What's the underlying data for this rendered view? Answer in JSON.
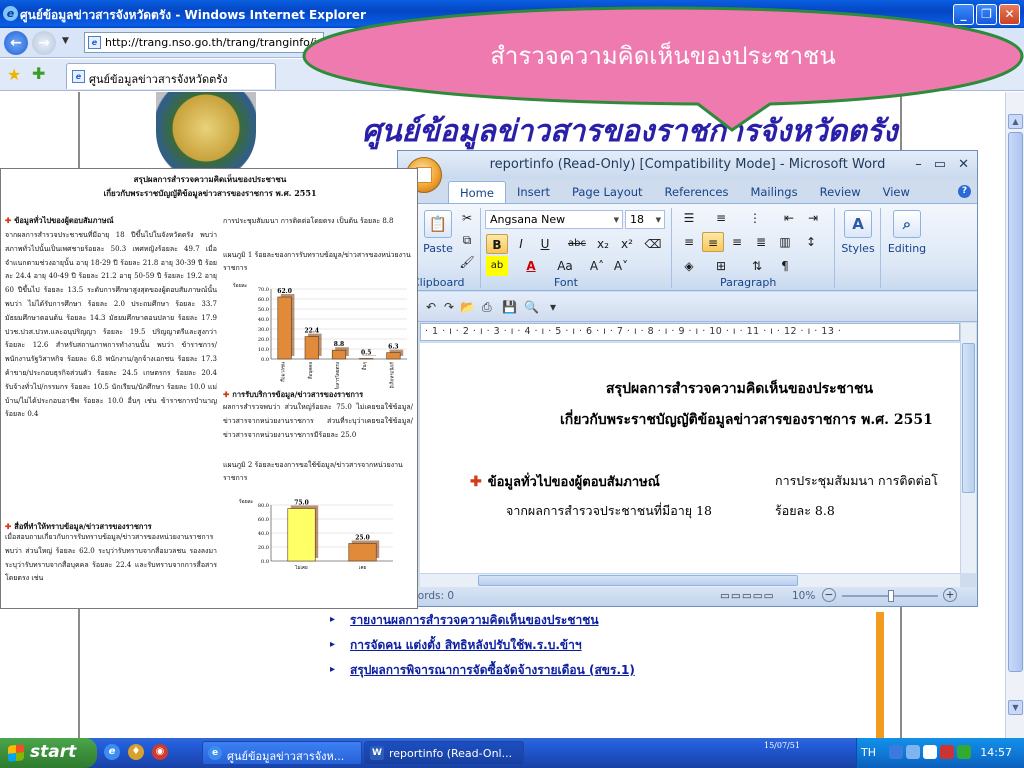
{
  "ie": {
    "title": "ศูนย์ข้อมูลข่าวสารจังหวัดตรัง - Windows Internet Explorer",
    "address": "http://trang.nso.go.th/trang/tranginfo/ind",
    "tab_label": "ศูนย์ข้อมูลข่าวสารจังหวัดตรัง",
    "icons": [
      "ie-icon",
      "back-icon",
      "forward-icon",
      "favorites-star-icon",
      "add-favorite-icon",
      "page-icon"
    ]
  },
  "site": {
    "heading": "ศูนย์ข้อมูลข่าวสารของราชการจังหวัดตรัง",
    "links": [
      "รายงานผลการสำรวจความคิดเห็นของประชาชน",
      "การจัดคน แต่งตั้ง สิทธิหลังปรับใช้พ.ร.บ.ข้าฯ",
      "สรุปผลการพิจารณาการจัดซื้อจัดจ้างรายเดือน (สขร.1)"
    ]
  },
  "callout": {
    "text": "สำรวจความคิดเห็นของประชาชน",
    "fill": "#ef7ab0",
    "stroke": "#2e8b3a"
  },
  "word": {
    "title": "reportinfo (Read-Only) [Compatibility Mode] - Microsoft Word",
    "tabs": [
      "Home",
      "Insert",
      "Page Layout",
      "References",
      "Mailings",
      "Review",
      "View"
    ],
    "active_tab": "Home",
    "font_name": "Angsana New",
    "font_size": "18",
    "groups": {
      "clipboard": "Clipboard",
      "font": "Font",
      "paragraph": "Paragraph",
      "styles": "Styles",
      "editing": "Editing",
      "paste": "Paste"
    },
    "ruler": "· 1 · ı · 2 · ı · 3 · ı · 4 · ı · 5 · ı · 6 · ı · 7 · ı · 8 · ı · 9 · ı · 10 · ı · 11 · ı · 12 · ı · 13 ·",
    "doc": {
      "title1": "สรุปผลการสำรวจความคิดเห็นของประชาชน",
      "title2": "เกี่ยวกับพระราชบัญญัติข้อมูลข่าวสารของราชการ พ.ศ. 2551",
      "heading1": "ข้อมูลทั่วไปของผู้ตอบสัมภาษณ์",
      "right1": "การประชุมสัมมนา การติดต่อโ",
      "para1": "จากผลการสำรวจประชาชนที่มีอายุ  18",
      "right2": "ร้อยละ  8.8"
    },
    "status_words": "Words: 0",
    "status_views": "▭▭▭▭▭",
    "zoom": "10%"
  },
  "report": {
    "title1": "สรุปผลการสำรวจความคิดเห็นของประชาชน",
    "title2": "เกี่ยวกับพระราชบัญญัติข้อมูลข่าวสารของราชการ พ.ศ. 2551",
    "h1": "ข้อมูลทั่วไปของผู้ตอบสัมภาษณ์",
    "left1": "จากผลการสำรวจประชาชนที่มีอายุ 18 ปีขึ้นไปในจังหวัดตรัง พบว่า สภาพทั่วไปนั้นเป็นเพศชายร้อยละ 50.3 เพศหญิงร้อยละ 49.7 เมื่อจำแนกตามช่วงอายุนั้น อายุ 18-29 ปี ร้อยละ 21.8 อายุ 30-39 ปี ร้อยละ 24.4 อายุ 40-49 ปี ร้อยละ 21.2 อายุ 50-59 ปี ร้อยละ 19.2 อายุ 60 ปีขึ้นไป ร้อยละ 13.5 ระดับการศึกษาสูงสุดของผู้ตอบสัมภาษณ์นั้น พบว่า ไม่ได้รับการศึกษา ร้อยละ 2.0 ประถมศึกษา ร้อยละ 33.7 มัธยมศึกษาตอนต้น ร้อยละ 14.3 มัธยมศึกษาตอนปลาย ร้อยละ 17.9 ปวช.ปวส.ปวท.และอนุปริญญา ร้อยละ 19.5 ปริญญาตรีและสูงกว่า ร้อยละ 12.6 สำหรับสถานภาพการทำงานนั้น พบว่า ข้าราชการ/พนักงานรัฐวิสาหกิจ ร้อยละ 6.8 พนักงาน/ลูกจ้างเอกชน ร้อยละ 17.3 ค้าขาย/ประกอบธุรกิจส่วนตัว ร้อยละ 24.5 เกษตรกร ร้อยละ 20.4 รับจ้างทั่วไป/กรรมกร ร้อยละ 10.5 นักเรียน/นักศึกษา ร้อยละ 10.0 แม่บ้าน/ไม่ได้ประกอบอาชีพ ร้อยละ 10.0 อื่นๆ เช่น ข้าราชการบำนาญ ร้อยละ 0.4",
    "h2": "สื่อที่ทำให้ทราบข้อมูล/ข่าวสารของราชการ",
    "left2": "เมื่อสอบถามเกี่ยวกับการรับทราบข้อมูล/ข่าวสารของหน่วยงานราชการ พบว่า ส่วนใหญ่ ร้อยละ 62.0 ระบุว่ารับทราบจากสื่อมวลชน รองลงมา ระบุว่ารับทราบจากสื่อบุคคล ร้อยละ 22.4 และรับทราบจากการสื่อสารโดยตรง เช่น",
    "right1": "การประชุมสัมมนา การติดต่อโดยตรง เป็นต้น ร้อยละ 8.8",
    "cap1": "แผนภูมิ 1  ร้อยละของการรับทราบข้อมูล/ข่าวสารของหน่วยงานราชการ",
    "h3": "การรับบริการข้อมูล/ข่าวสารของราชการ",
    "right2": "ผลการสำรวจพบว่า ส่วนใหญ่ร้อยละ 75.0 ไม่เคยขอใช้ข้อมูล/ข่าวสารจากหน่วยงานราชการ ส่วนที่ระบุว่าเคยขอใช้ข้อมูล/ข่าวสารจากหน่วยงานราชการมีร้อยละ 25.0",
    "cap2": "แผนภูมิ 2  ร้อยละของการขอใช้ข้อมูล/ข่าวสารจากหน่วยงานราชการ"
  },
  "chart_data": [
    {
      "type": "bar",
      "ylabel": "ร้อยละ",
      "ylim": [
        0,
        70
      ],
      "yticks": [
        "0.0",
        "10.0",
        "20.0",
        "30.0",
        "40.0",
        "50.0",
        "60.0",
        "70.0"
      ],
      "categories": [
        "สื่อมวลชน",
        "สื่อบุคคล",
        "สื่อสารโดยตรง",
        "อื่นๆ",
        "อิเล็กทรอนิกส์"
      ],
      "values": [
        62.0,
        22.4,
        8.8,
        0.5,
        6.3
      ],
      "labels": [
        "62.0",
        "22.4",
        "8.8",
        "0.5",
        "6.3"
      ],
      "bar_color": "#e08a3a"
    },
    {
      "type": "bar",
      "ylabel": "ร้อยละ",
      "ylim": [
        0,
        80
      ],
      "yticks": [
        "0.0",
        "20.0",
        "40.0",
        "60.0",
        "80.0"
      ],
      "categories": [
        "ไม่เคย",
        "เคย"
      ],
      "values": [
        75.0,
        25.0
      ],
      "labels": [
        "75.0",
        "25.0"
      ],
      "bar_colors": [
        "#ffff66",
        "#e08a3a"
      ]
    }
  ],
  "taskbar": {
    "start": "start",
    "tasks": [
      "ศูนย์ข้อมูลข่าวสารจังห...",
      "reportinfo (Read-Onl..."
    ],
    "lang": "TH",
    "time": "14:57",
    "desk_date": "15/07/51"
  }
}
